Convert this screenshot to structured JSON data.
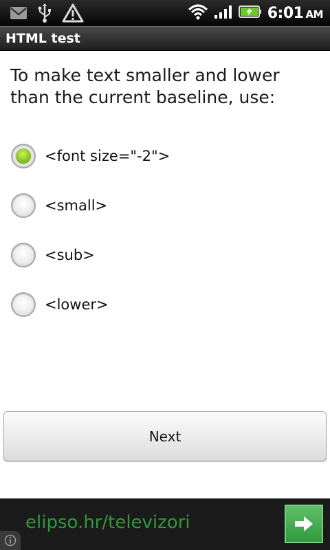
{
  "status_bar": {
    "time": "6:01",
    "ampm": "AM",
    "icons": [
      "gmail-icon",
      "usb-icon",
      "warning-icon",
      "wifi-icon",
      "signal-icon",
      "battery-charging-icon"
    ]
  },
  "app": {
    "title": "HTML test"
  },
  "quiz": {
    "question": "To make text smaller and lower than the current baseline, use:",
    "options": [
      {
        "label": "<font size=\"-2\">",
        "selected": true
      },
      {
        "label": "<small>",
        "selected": false
      },
      {
        "label": "<sub>",
        "selected": false
      },
      {
        "label": "<lower>",
        "selected": false
      }
    ],
    "next_label": "Next"
  },
  "ad": {
    "text": "elipso.hr/televizori",
    "text_color": "#2e9a3a",
    "arrow_icon": "arrow-right-icon",
    "info_icon": "info-icon"
  }
}
